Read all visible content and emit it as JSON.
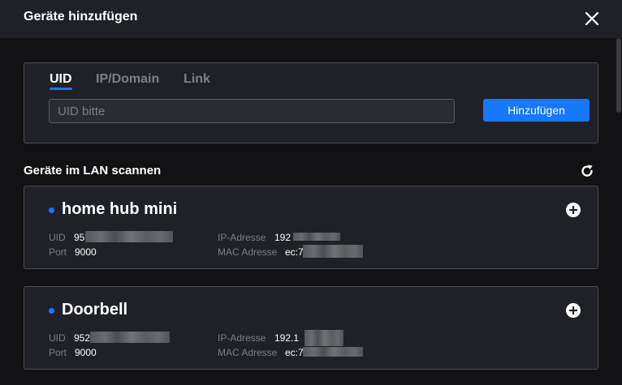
{
  "dialog": {
    "title": "Geräte hinzufügen"
  },
  "tabs": [
    {
      "label": "UID",
      "active": true
    },
    {
      "label": "IP/Domain",
      "active": false
    },
    {
      "label": "Link",
      "active": false
    }
  ],
  "uid_input": {
    "value": "",
    "placeholder": "UID bitte"
  },
  "add_button": {
    "label": "Hinzufügen"
  },
  "lan_scan": {
    "title": "Geräte im LAN scannen"
  },
  "labels": {
    "uid": "UID",
    "port": "Port",
    "ip": "IP-Adresse",
    "mac": "MAC Adresse"
  },
  "devices": [
    {
      "name": "home hub mini",
      "uid_prefix": "95",
      "port": "9000",
      "ip_prefix": "192",
      "mac_prefix": "ec:7"
    },
    {
      "name": "Doorbell",
      "uid_prefix": "952",
      "port": "9000",
      "ip_prefix": "192.1",
      "mac_prefix": "ec:7"
    }
  ],
  "colors": {
    "accent": "#1677ff",
    "background": "#121214",
    "panel": "#1f2126",
    "border": "#4a4c52"
  },
  "icons": {
    "close": "close-icon",
    "refresh": "refresh-icon",
    "add_device": "plus-circle-icon"
  }
}
